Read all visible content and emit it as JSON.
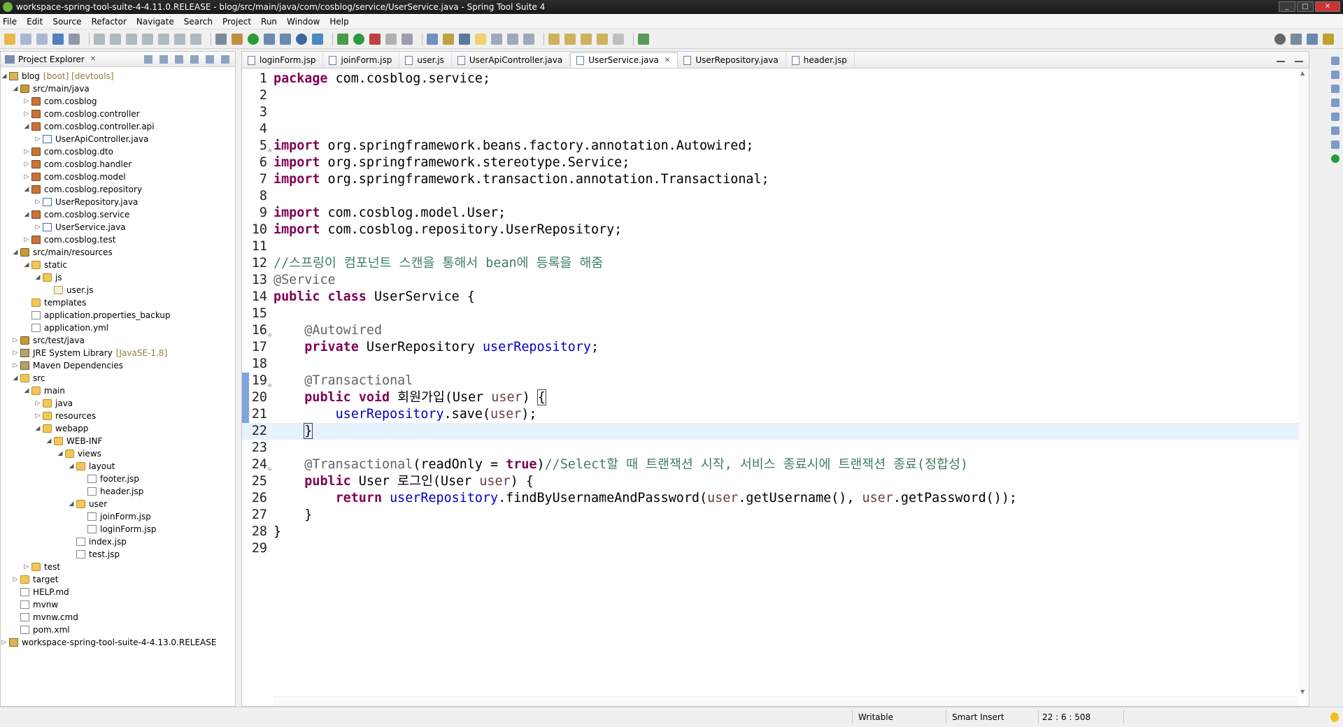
{
  "window": {
    "title": "workspace-spring-tool-suite-4-4.11.0.RELEASE - blog/src/main/java/com/cosblog/service/UserService.java - Spring Tool Suite 4",
    "controls": [
      "_",
      "□",
      "✕"
    ]
  },
  "menu": [
    "File",
    "Edit",
    "Source",
    "Refactor",
    "Navigate",
    "Search",
    "Project",
    "Run",
    "Window",
    "Help"
  ],
  "explorer": {
    "title": "Project Explorer",
    "tree": [
      {
        "depth": 0,
        "label": "blog",
        "deco": "[boot] [devtools]",
        "icon": "project",
        "arrow": "open"
      },
      {
        "depth": 1,
        "label": "src/main/java",
        "icon": "srcfolder",
        "arrow": "open"
      },
      {
        "depth": 2,
        "label": "com.cosblog",
        "icon": "package",
        "arrow": "closed"
      },
      {
        "depth": 2,
        "label": "com.cosblog.controller",
        "icon": "package",
        "arrow": "closed"
      },
      {
        "depth": 2,
        "label": "com.cosblog.controller.api",
        "icon": "package",
        "arrow": "open"
      },
      {
        "depth": 3,
        "label": "UserApiController.java",
        "icon": "java",
        "arrow": "closed"
      },
      {
        "depth": 2,
        "label": "com.cosblog.dto",
        "icon": "package",
        "arrow": "closed"
      },
      {
        "depth": 2,
        "label": "com.cosblog.handler",
        "icon": "package",
        "arrow": "closed"
      },
      {
        "depth": 2,
        "label": "com.cosblog.model",
        "icon": "package",
        "arrow": "closed"
      },
      {
        "depth": 2,
        "label": "com.cosblog.repository",
        "icon": "package",
        "arrow": "open"
      },
      {
        "depth": 3,
        "label": "UserRepository.java",
        "icon": "java",
        "arrow": "closed"
      },
      {
        "depth": 2,
        "label": "com.cosblog.service",
        "icon": "package",
        "arrow": "open"
      },
      {
        "depth": 3,
        "label": "UserService.java",
        "icon": "java",
        "arrow": "closed"
      },
      {
        "depth": 2,
        "label": "com.cosblog.test",
        "icon": "package",
        "arrow": "closed"
      },
      {
        "depth": 1,
        "label": "src/main/resources",
        "icon": "srcfolder",
        "arrow": "open"
      },
      {
        "depth": 2,
        "label": "static",
        "icon": "folder",
        "arrow": "open"
      },
      {
        "depth": 3,
        "label": "js",
        "icon": "folder",
        "arrow": "open"
      },
      {
        "depth": 4,
        "label": "user.js",
        "icon": "jsfile",
        "arrow": "none"
      },
      {
        "depth": 2,
        "label": "templates",
        "icon": "folder",
        "arrow": "none"
      },
      {
        "depth": 2,
        "label": "application.properties_backup",
        "icon": "file",
        "arrow": "none"
      },
      {
        "depth": 2,
        "label": "application.yml",
        "icon": "file",
        "arrow": "none"
      },
      {
        "depth": 1,
        "label": "src/test/java",
        "icon": "srcfolder",
        "arrow": "closed"
      },
      {
        "depth": 1,
        "label": "JRE System Library",
        "deco": "[JavaSE-1.8]",
        "icon": "lib",
        "arrow": "closed"
      },
      {
        "depth": 1,
        "label": "Maven Dependencies",
        "icon": "lib",
        "arrow": "closed"
      },
      {
        "depth": 1,
        "label": "src",
        "icon": "folder",
        "arrow": "open"
      },
      {
        "depth": 2,
        "label": "main",
        "icon": "folder",
        "arrow": "open"
      },
      {
        "depth": 3,
        "label": "java",
        "icon": "folder",
        "arrow": "closed"
      },
      {
        "depth": 3,
        "label": "resources",
        "icon": "folder",
        "arrow": "closed"
      },
      {
        "depth": 3,
        "label": "webapp",
        "icon": "folder",
        "arrow": "open"
      },
      {
        "depth": 4,
        "label": "WEB-INF",
        "icon": "folder",
        "arrow": "open"
      },
      {
        "depth": 5,
        "label": "views",
        "icon": "folder",
        "arrow": "open"
      },
      {
        "depth": 6,
        "label": "layout",
        "icon": "folder",
        "arrow": "open"
      },
      {
        "depth": 7,
        "label": "footer.jsp",
        "icon": "file",
        "arrow": "none"
      },
      {
        "depth": 7,
        "label": "header.jsp",
        "icon": "file",
        "arrow": "none"
      },
      {
        "depth": 6,
        "label": "user",
        "icon": "folder",
        "arrow": "open"
      },
      {
        "depth": 7,
        "label": "joinForm.jsp",
        "icon": "file",
        "arrow": "none"
      },
      {
        "depth": 7,
        "label": "loginForm.jsp",
        "icon": "file",
        "arrow": "none"
      },
      {
        "depth": 6,
        "label": "index.jsp",
        "icon": "file",
        "arrow": "none"
      },
      {
        "depth": 6,
        "label": "test.jsp",
        "icon": "file",
        "arrow": "none"
      },
      {
        "depth": 2,
        "label": "test",
        "icon": "folder",
        "arrow": "closed"
      },
      {
        "depth": 1,
        "label": "target",
        "icon": "folder",
        "arrow": "closed"
      },
      {
        "depth": 1,
        "label": "HELP.md",
        "icon": "file",
        "arrow": "none"
      },
      {
        "depth": 1,
        "label": "mvnw",
        "icon": "file",
        "arrow": "none"
      },
      {
        "depth": 1,
        "label": "mvnw.cmd",
        "icon": "file",
        "arrow": "none"
      },
      {
        "depth": 1,
        "label": "pom.xml",
        "icon": "file",
        "arrow": "none"
      },
      {
        "depth": 0,
        "label": "workspace-spring-tool-suite-4-4.13.0.RELEASE",
        "icon": "project",
        "arrow": "closed"
      }
    ]
  },
  "editor": {
    "tabs": [
      {
        "label": "loginForm.jsp",
        "active": false
      },
      {
        "label": "joinForm.jsp",
        "active": false
      },
      {
        "label": "user.js",
        "active": false
      },
      {
        "label": "UserApiController.java",
        "active": false
      },
      {
        "label": "UserService.java",
        "active": true
      },
      {
        "label": "UserRepository.java",
        "active": false
      },
      {
        "label": "header.jsp",
        "active": false
      }
    ],
    "current_line": 22,
    "changed_lines": [
      19,
      22
    ],
    "folds": [
      5,
      16,
      19,
      24
    ],
    "lines": [
      [
        [
          "k",
          "package"
        ],
        [
          "t",
          " com.cosblog.service;"
        ]
      ],
      [],
      [],
      [],
      [
        [
          "k",
          "import"
        ],
        [
          "t",
          " org.springframework.beans.factory.annotation.Autowired;"
        ]
      ],
      [
        [
          "k",
          "import"
        ],
        [
          "t",
          " org.springframework.stereotype.Service;"
        ]
      ],
      [
        [
          "k",
          "import"
        ],
        [
          "t",
          " org.springframework.transaction.annotation.Transactional;"
        ]
      ],
      [],
      [
        [
          "k",
          "import"
        ],
        [
          "t",
          " com.cosblog.model.User;"
        ]
      ],
      [
        [
          "k",
          "import"
        ],
        [
          "t",
          " com.cosblog.repository.UserRepository;"
        ]
      ],
      [],
      [
        [
          "c",
          "//스프링이 컴포넌트 스캔을 통해서 bean에 등록을 해줌"
        ]
      ],
      [
        [
          "a",
          "@Service"
        ]
      ],
      [
        [
          "k",
          "public"
        ],
        [
          "t",
          " "
        ],
        [
          "k",
          "class"
        ],
        [
          "t",
          " UserService {"
        ]
      ],
      [],
      [
        [
          "t",
          "    "
        ],
        [
          "a",
          "@Autowired"
        ]
      ],
      [
        [
          "t",
          "    "
        ],
        [
          "k",
          "private"
        ],
        [
          "t",
          " UserRepository "
        ],
        [
          "f",
          "userRepository"
        ],
        [
          "t",
          ";"
        ]
      ],
      [],
      [
        [
          "t",
          "    "
        ],
        [
          "a",
          "@Transactional"
        ]
      ],
      [
        [
          "t",
          "    "
        ],
        [
          "k",
          "public"
        ],
        [
          "t",
          " "
        ],
        [
          "k",
          "void"
        ],
        [
          "t",
          " 회원가입(User "
        ],
        [
          "v",
          "user"
        ],
        [
          "t",
          ") "
        ],
        [
          "br",
          "{"
        ]
      ],
      [
        [
          "t",
          "        "
        ],
        [
          "f",
          "userRepository"
        ],
        [
          "t",
          ".save("
        ],
        [
          "v",
          "user"
        ],
        [
          "t",
          ");"
        ]
      ],
      [
        [
          "t",
          "    "
        ],
        [
          "br",
          "}"
        ]
      ],
      [],
      [
        [
          "t",
          "    "
        ],
        [
          "a",
          "@Transactional"
        ],
        [
          "t",
          "(readOnly = "
        ],
        [
          "k",
          "true"
        ],
        [
          "t",
          ")"
        ],
        [
          "c",
          "//Select할 때 트랜잭션 시작, 서비스 종료시에 트랜잭션 종료(정합성)"
        ]
      ],
      [
        [
          "t",
          "    "
        ],
        [
          "k",
          "public"
        ],
        [
          "t",
          " User 로그인(User "
        ],
        [
          "v",
          "user"
        ],
        [
          "t",
          ") {"
        ]
      ],
      [
        [
          "t",
          "        "
        ],
        [
          "k",
          "return"
        ],
        [
          "t",
          " "
        ],
        [
          "f",
          "userRepository"
        ],
        [
          "t",
          ".findByUsernameAndPassword("
        ],
        [
          "v",
          "user"
        ],
        [
          "t",
          ".getUsername(), "
        ],
        [
          "v",
          "user"
        ],
        [
          "t",
          ".getPassword());"
        ]
      ],
      [
        [
          "t",
          "    }"
        ]
      ],
      [
        [
          "t",
          "}"
        ]
      ],
      []
    ]
  },
  "status": {
    "mode": "Writable",
    "insert": "Smart Insert",
    "position": "22 : 6 : 508"
  }
}
